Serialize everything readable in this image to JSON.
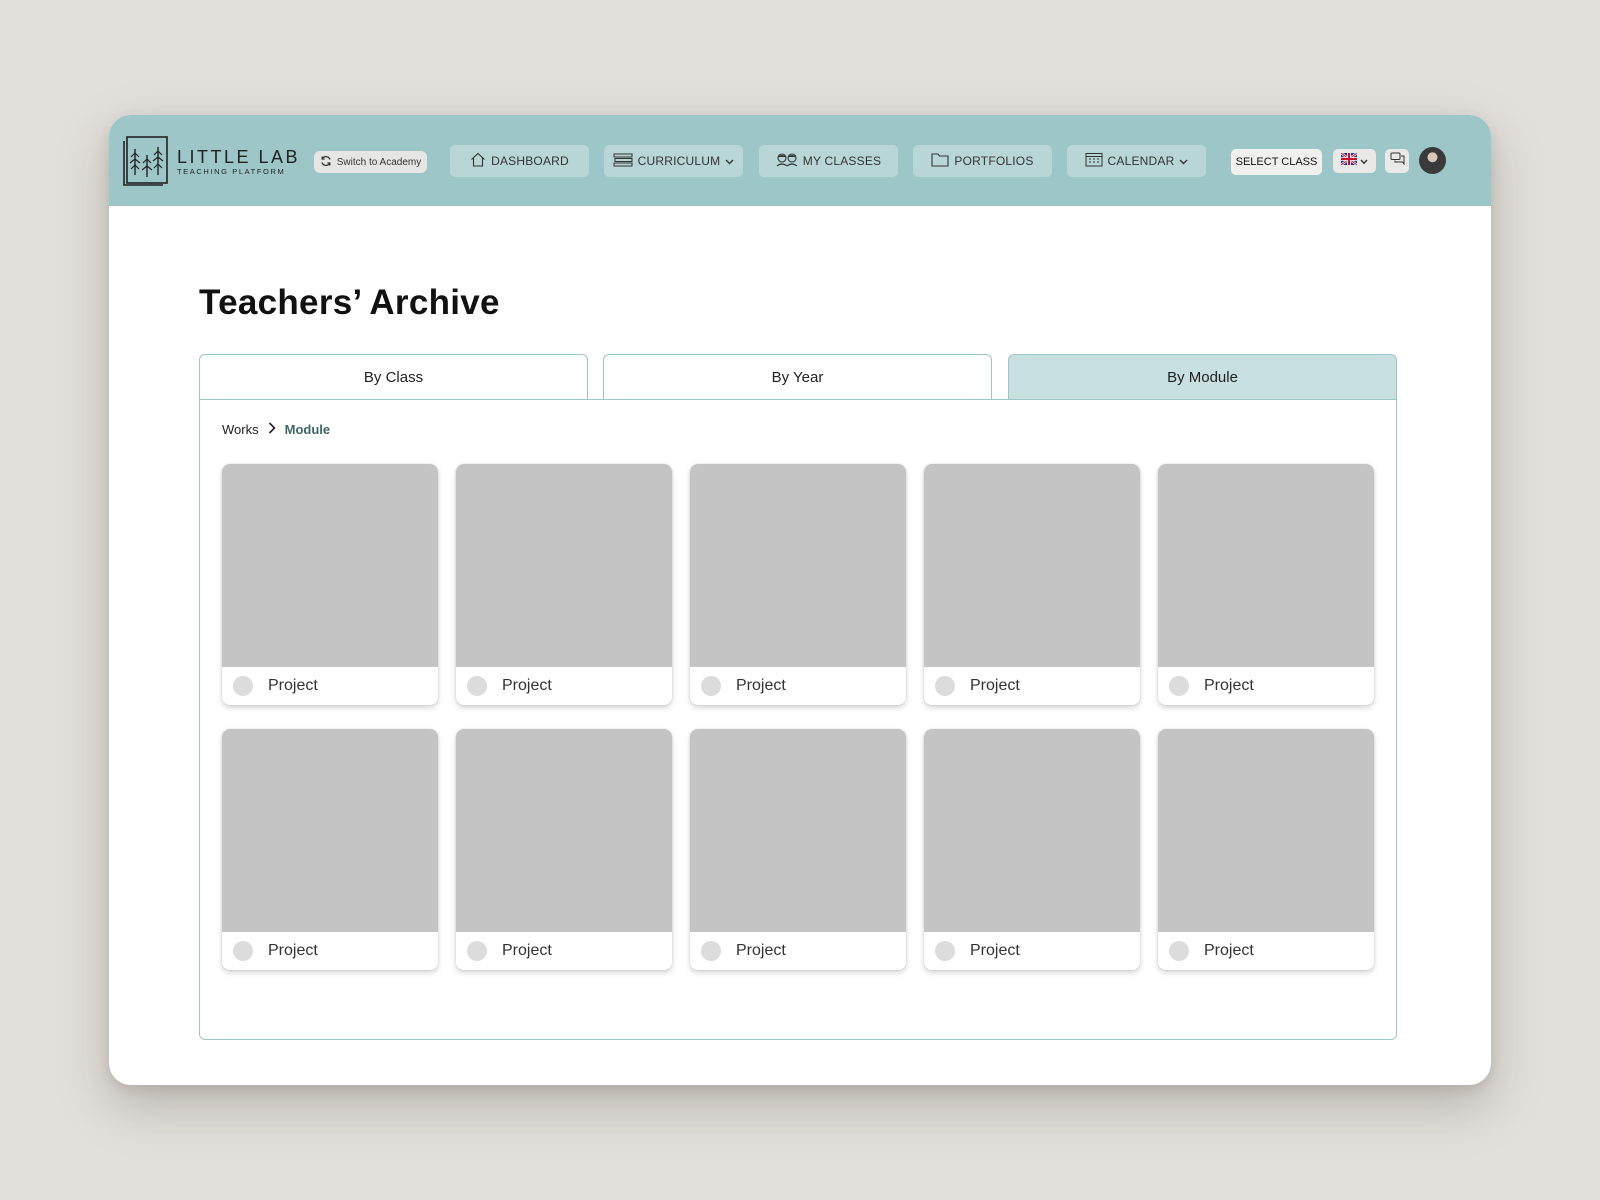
{
  "app": {
    "logo_title": "LITTLE LAB",
    "logo_subtitle": "TEACHING PLATFORM"
  },
  "header": {
    "switch_label": "Switch to Academy",
    "nav": [
      {
        "label": "DASHBOARD",
        "icon": "home-icon"
      },
      {
        "label": "CURRICULUM",
        "icon": "books-icon",
        "dropdown": true
      },
      {
        "label": "MY CLASSES",
        "icon": "students-icon"
      },
      {
        "label": "PORTFOLIOS",
        "icon": "folder-icon"
      },
      {
        "label": "CALENDAR",
        "icon": "calendar-icon",
        "dropdown": true
      }
    ],
    "select_class_label": "SELECT CLASS",
    "language_icon": "uk-flag-icon",
    "chat_icon": "chat-icon"
  },
  "page": {
    "title": "Teachers’ Archive",
    "tabs": [
      {
        "label": "By Class",
        "active": false
      },
      {
        "label": "By Year",
        "active": false
      },
      {
        "label": "By Module",
        "active": true
      }
    ],
    "breadcrumb": {
      "root": "Works",
      "current": "Module"
    },
    "cards": [
      {
        "label": "Project"
      },
      {
        "label": "Project"
      },
      {
        "label": "Project"
      },
      {
        "label": "Project"
      },
      {
        "label": "Project"
      },
      {
        "label": "Project"
      },
      {
        "label": "Project"
      },
      {
        "label": "Project"
      },
      {
        "label": "Project"
      },
      {
        "label": "Project"
      }
    ]
  },
  "colors": {
    "background": "#e3dfdb",
    "header": "#9cc6c7",
    "nav_button": "#b8d6d6",
    "active_tab": "#c8e0e0",
    "thumbnail": "#c4c4c4",
    "breadcrumb_current": "#3f6767"
  }
}
